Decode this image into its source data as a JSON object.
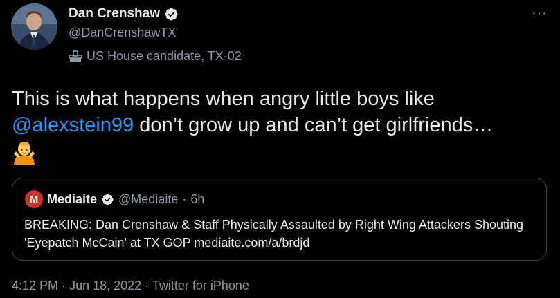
{
  "author": {
    "name": "Dan Crenshaw",
    "handle": "@DanCrenshawTX",
    "label": "US House candidate, TX-02"
  },
  "more_icon": "more-icon",
  "tweet": {
    "text_before": "This is what happens when angry little boys like ",
    "mention": "@alexstein99",
    "text_after": " don’t grow up and can’t get girlfriends…",
    "emoji": "person-shrugging"
  },
  "quote": {
    "logo_letter": "M",
    "name": "Mediaite",
    "handle": "@Mediaite",
    "separator": "·",
    "time": "6h",
    "text": "BREAKING: Dan Crenshaw & Staff Physically Assaulted by Right Wing Attackers Shouting 'Eyepatch McCain' at TX GOP mediaite.com/a/brdjd"
  },
  "meta": {
    "time": "4:12 PM",
    "date": "Jun 18, 2022",
    "source": "Twitter for iPhone",
    "separator": "·"
  },
  "colors": {
    "background": "#000000",
    "text": "#e7e9ea",
    "muted": "#8b98a5",
    "link": "#1d9bf0",
    "verified": "#e7e9ea",
    "mediaite_red": "#d3322b"
  }
}
